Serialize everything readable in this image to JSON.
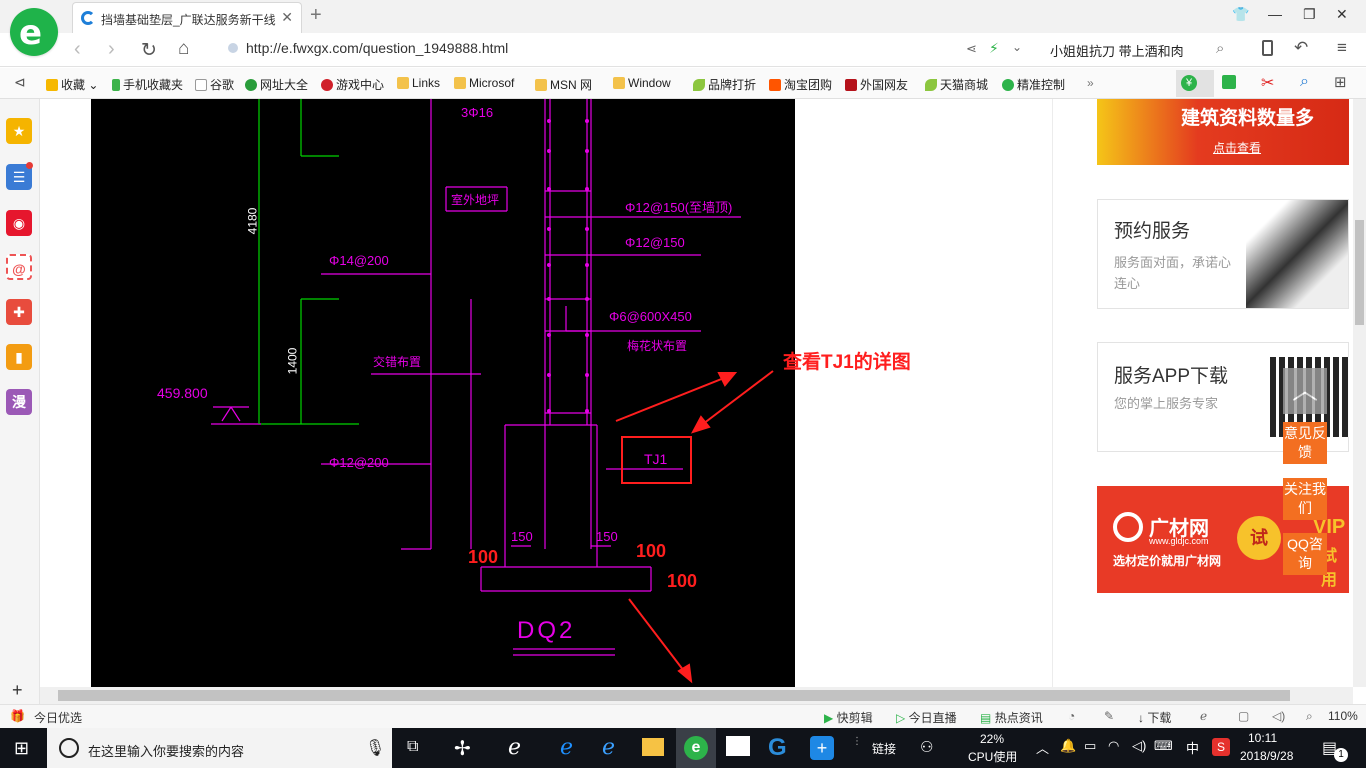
{
  "browser": {
    "tab_title": "挡墙基础垫层_广联达服务新干线",
    "url": "http://e.fwxgx.com/question_1949888.html",
    "hot_search": "小姐姐抗刀 带上酒和肉"
  },
  "bookmarks": [
    {
      "label": "收藏",
      "icon": "star-icon"
    },
    {
      "label": "手机收藏夹",
      "icon": "phone-icon"
    },
    {
      "label": "谷歌",
      "icon": "page-icon"
    },
    {
      "label": "网址大全",
      "icon": "web-icon"
    },
    {
      "label": "游戏中心",
      "icon": "game-icon"
    },
    {
      "label": "Links",
      "icon": "folder-icon"
    },
    {
      "label": "Microsof",
      "icon": "folder-icon"
    },
    {
      "label": "MSN 网",
      "icon": "folder-icon"
    },
    {
      "label": "Window",
      "icon": "folder-icon"
    },
    {
      "label": "品牌打折",
      "icon": "leaf-icon"
    },
    {
      "label": "淘宝团购",
      "icon": "taobao-icon"
    },
    {
      "label": "外国网友",
      "icon": "foreign-icon"
    },
    {
      "label": "天猫商城",
      "icon": "leaf-icon"
    },
    {
      "label": "精准控制",
      "icon": "chat-icon"
    }
  ],
  "sidebar_icons": [
    "star-icon",
    "news-icon",
    "weibo-icon",
    "mail-icon",
    "game-icon",
    "book-icon",
    "comic-icon"
  ],
  "sidebar_comic_label": "漫",
  "cad": {
    "dims_vertical": [
      "4180",
      "1400"
    ],
    "labels": {
      "rebar_top": "3Φ16",
      "outdoor_floor": "室外地坪",
      "rebar_150_to_top": "Φ12@150(至墙顶)",
      "rebar_150": "Φ12@150",
      "rebar_14_200": "Φ14@200",
      "rebar_6": "Φ6@600X450",
      "plum_layout": "梅花状布置",
      "staggered": "交错布置",
      "elevation": "459.800",
      "rebar_12_200": "Φ12@200",
      "tj1": "TJ1",
      "w150a": "150",
      "w150b": "150",
      "footing_name": "DQ2"
    },
    "annotations": {
      "view_detail": "查看TJ1的详图",
      "dim_100_left": "100",
      "dim_100_right": "100",
      "dim_100_bottom": "100"
    },
    "colors": {
      "line_magenta": "#e600e6",
      "line_green": "#00d400",
      "annotation_red": "#ff1e1e"
    }
  },
  "ads": {
    "banner_text": "建筑资料数量多",
    "banner_link": "点击查看",
    "service_title": "预约服务",
    "service_sub": "服务面对面，承诺心连心",
    "app_title": "服务APP下载",
    "app_sub": "您的掌上服务专家",
    "gcw_brand": "广材网",
    "gcw_url": "www.gldjc.com",
    "gcw_slogan": "选材定价就用广材网",
    "gcw_trial": "试",
    "gcw_vip": "VIP",
    "gcw_vip_suffix": "试用"
  },
  "float_buttons": [
    "意见反馈",
    "关注我们",
    "QQ咨询"
  ],
  "statusbar": {
    "left": "今日优选",
    "items": [
      "快剪辑",
      "今日直播",
      "热点资讯",
      "下载"
    ],
    "zoom": "110%"
  },
  "taskbar": {
    "search_placeholder": "在这里输入你要搜索的内容",
    "links": "链接",
    "cpu_percent": "22%",
    "cpu_label": "CPU使用",
    "ime": "中",
    "time": "10:11",
    "date": "2018/9/28",
    "notifications": "1"
  }
}
